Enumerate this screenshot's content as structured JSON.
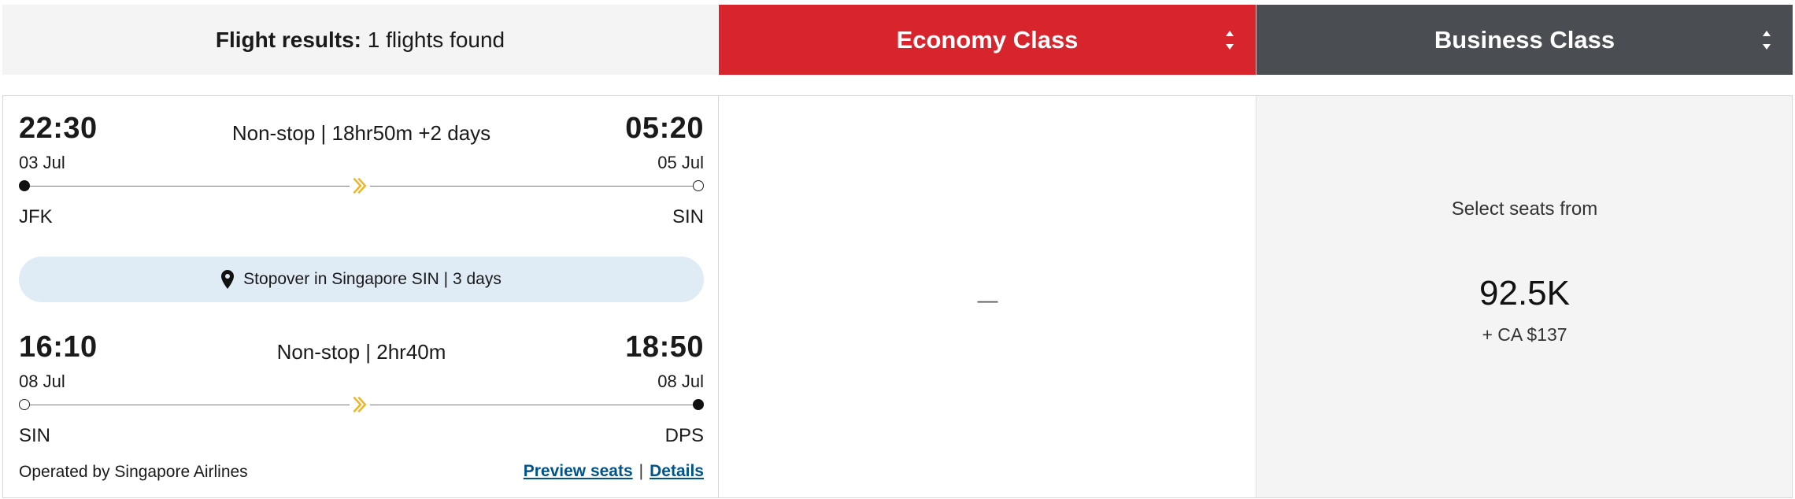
{
  "header": {
    "results_label": "Flight results:",
    "results_count": "1 flights found",
    "tabs": [
      {
        "label": "Economy Class",
        "color": "#d8252d"
      },
      {
        "label": "Business Class",
        "color": "#4a4d52"
      }
    ]
  },
  "result": {
    "segments": [
      {
        "dep_time": "22:30",
        "dep_date": "03 Jul",
        "dep_airport": "JFK",
        "arr_time": "05:20",
        "arr_date": "05 Jul",
        "arr_airport": "SIN",
        "duration": "Non-stop | 18hr50m +2 days"
      },
      {
        "dep_time": "16:10",
        "dep_date": "08 Jul",
        "dep_airport": "SIN",
        "arr_time": "18:50",
        "arr_date": "08 Jul",
        "arr_airport": "DPS",
        "duration": "Non-stop | 2hr40m"
      }
    ],
    "stopover": "Stopover in Singapore SIN | 3 days",
    "operated_by": "Operated by Singapore Airlines",
    "preview_seats": "Preview seats",
    "link_sep": "|",
    "details": "Details",
    "economy": {
      "value": "—"
    },
    "business": {
      "label": "Select seats from",
      "miles": "92.5K",
      "fee": "+ CA $137"
    }
  },
  "icons": {
    "plane": "airline-tail-logo-icon",
    "pin": "location-pin-icon",
    "sort": "sort-arrows-icon"
  }
}
